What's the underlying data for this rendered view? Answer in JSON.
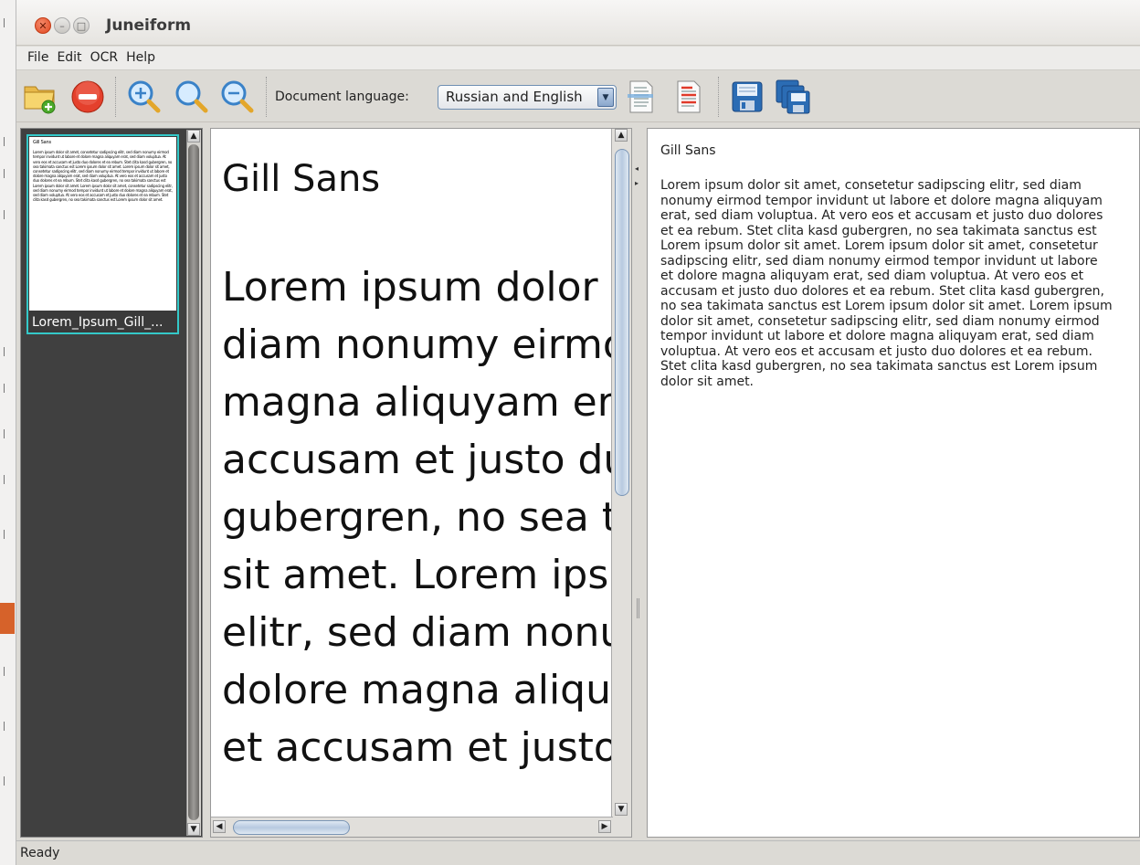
{
  "window": {
    "title": "Juneiform"
  },
  "menu": [
    "File",
    "Edit",
    "OCR",
    "Help"
  ],
  "toolbar": {
    "language_label": "Document language:",
    "language_value": "Russian and English"
  },
  "thumbnails": [
    {
      "caption": "Lorem_Ipsum_Gill_...",
      "page_title": "Gill Sans"
    }
  ],
  "image_view": {
    "title": "Gill Sans",
    "lines": [
      "Lorem ipsum dolor s",
      "diam nonumy eirmo",
      "magna aliquyam erat",
      "accusam et justo duc",
      "gubergren, no sea ta",
      "sit amet. Lorem ipsu",
      "elitr, sed diam nonur",
      "dolore magna aliquya",
      "et accusam et justo d"
    ]
  },
  "text_view": {
    "title": "Gill Sans",
    "body": "Lorem ipsum dolor sit amet, consetetur sadipscing elitr, sed diam nonumy eirmod tempor invidunt ut labore et dolore magna aliquyam erat, sed diam voluptua. At vero eos et accusam et justo duo dolores et ea rebum. Stet clita kasd gubergren, no sea takimata sanctus est Lorem ipsum dolor sit amet. Lorem ipsum dolor sit amet, consetetur sadipscing elitr, sed diam nonumy eirmod tempor invidunt ut labore et dolore magna aliquyam erat, sed diam voluptua. At vero eos et accusam et justo duo dolores et ea rebum. Stet clita kasd gubergren, no sea takimata sanctus est Lorem ipsum dolor sit amet. Lorem ipsum dolor sit amet, consetetur sadipscing elitr, sed diam nonumy eirmod tempor invidunt ut labore et dolore magna aliquyam erat, sed diam voluptua. At vero eos et accusam et justo duo dolores et ea rebum. Stet clita kasd gubergren, no sea takimata sanctus est Lorem ipsum dolor sit amet."
  },
  "status": {
    "text": "Ready"
  },
  "icons": {
    "open": "open-folder-icon",
    "remove": "remove-icon",
    "zoom_in": "zoom-in-icon",
    "zoom_fit": "zoom-fit-icon",
    "zoom_out": "zoom-out-icon",
    "recognize_page": "recognize-page-icon",
    "recognize_all": "recognize-all-icon",
    "save": "save-icon",
    "save_all": "save-all-icon"
  }
}
